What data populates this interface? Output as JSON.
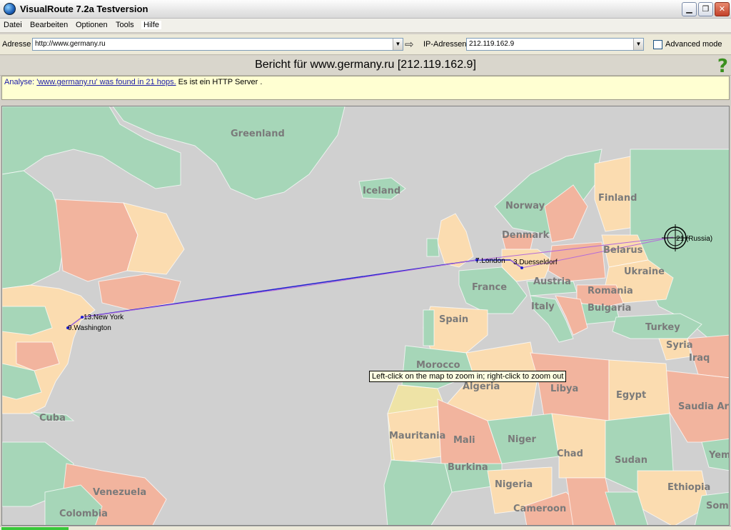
{
  "window": {
    "title": "VisualRoute 7.2a Testversion"
  },
  "menu": [
    "Datei",
    "Bearbeiten",
    "Optionen",
    "Tools",
    "Hilfe"
  ],
  "address": {
    "label": "Adresse",
    "value": "http://www.germany.ru",
    "ip_label": "IP-Adressen",
    "ip_value": "212.119.162.9",
    "advanced_label": "Advanced mode"
  },
  "report": {
    "title": "Bericht für www.germany.ru [212.119.162.9]"
  },
  "analysis": {
    "prefix": "Analyse: ",
    "link": "'www.germany.ru' was found in 21 hops.",
    "suffix": " Es ist ein HTTP Server ."
  },
  "map": {
    "tooltip": "Left-click on the map to zoom in; right-click to zoom out",
    "colors": {
      "ocean": "#d0d0d0",
      "green": "#a6d6b8",
      "salmon": "#f2b49e",
      "peach": "#fbdcb0",
      "beige": "#eee3a6",
      "route": "#1f1fd0",
      "route_alt": "#b36ad9"
    },
    "country_labels": [
      "Greenland",
      "Iceland",
      "Norway",
      "Finland",
      "Denmark",
      "Belarus",
      "Ukraine",
      "France",
      "Austria",
      "Romania",
      "Italy",
      "Bulgaria",
      "Spain",
      "Turkey",
      "Syria",
      "Iraq",
      "Morocco",
      "Algeria",
      "Libya",
      "Egypt",
      "Saudia Ara",
      "Mauritania",
      "Mali",
      "Niger",
      "Chad",
      "Sudan",
      "Yem",
      "Burkina",
      "Nigeria",
      "Ethiopia",
      "Cameroon",
      "Som",
      "Cuba",
      "Venezuela",
      "Colombia"
    ],
    "hops": [
      "13.New York",
      "9.Washington",
      "7.London",
      "3.Duesseldorf",
      "21 (Russia)"
    ]
  }
}
